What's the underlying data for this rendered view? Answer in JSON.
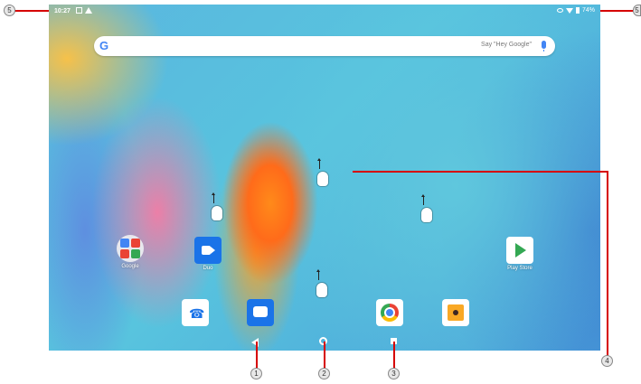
{
  "status_bar": {
    "time": "10:27",
    "battery": "74%"
  },
  "search": {
    "logo": "G",
    "hint": "Say \"Hey Google\""
  },
  "apps": {
    "google_folder": {
      "label": "Google"
    },
    "duo": {
      "label": "Duo"
    },
    "play_store": {
      "label": "Play Store"
    },
    "phone": {
      "label": ""
    },
    "messages": {
      "label": ""
    },
    "chrome": {
      "label": ""
    },
    "music": {
      "label": ""
    }
  },
  "callouts": [
    "1",
    "2",
    "3",
    "4",
    "5",
    "5"
  ],
  "colors": {
    "callout_line": "#d60000",
    "wallpaper_main": "#58c4de",
    "wallpaper_accent": "#ff7a1a"
  },
  "icons": [
    "image-icon",
    "warning-icon",
    "eye-icon",
    "wifi-icon",
    "battery-icon",
    "mic-icon",
    "back-icon",
    "home-icon",
    "recents-icon",
    "swipe-up-gesture-icon"
  ]
}
